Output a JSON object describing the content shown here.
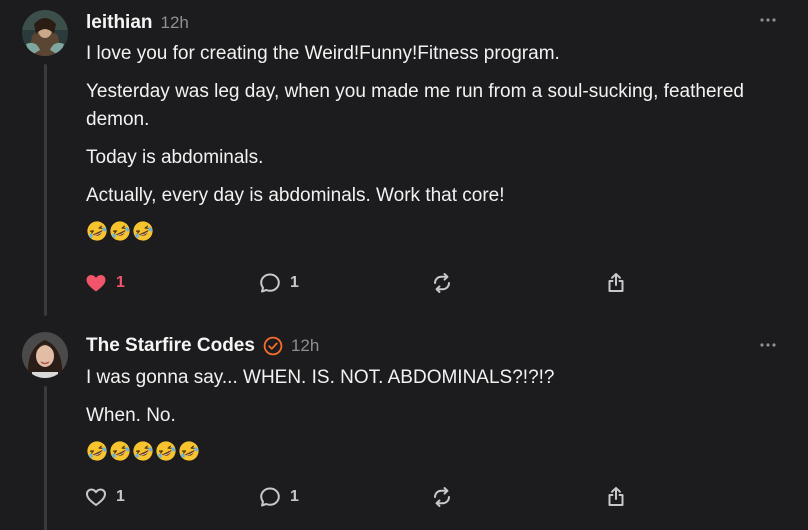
{
  "posts": [
    {
      "username": "leithian",
      "timestamp": "12h",
      "paragraphs": [
        "I love you for creating the Weird!Funny!Fitness program.",
        "Yesterday was leg day, when you made me run from a soul-sucking, feathered demon.",
        "Today is abdominals.",
        "Actually, every day is abdominals. Work that core!"
      ],
      "emoji_count": 3,
      "emoji_name": "rolling-on-floor-laughing",
      "likes": "1",
      "liked": true,
      "replies": "1",
      "like_color": "#f0556a"
    },
    {
      "username": "The Starfire Codes",
      "verified": true,
      "timestamp": "12h",
      "paragraphs": [
        "I was gonna say... WHEN. IS. NOT. ABDOMINALS?!?!?",
        "When. No."
      ],
      "emoji_count": 5,
      "emoji_name": "rolling-on-floor-laughing",
      "likes": "1",
      "liked": false,
      "replies": "1",
      "verified_color": "#f46d2b"
    }
  ]
}
